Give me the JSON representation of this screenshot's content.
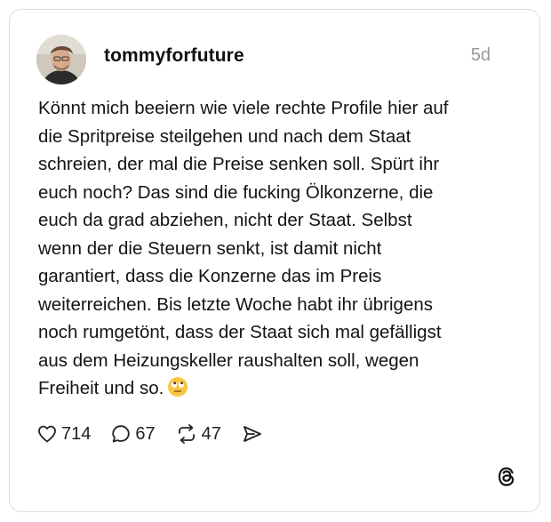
{
  "post": {
    "username": "tommyforfuture",
    "timestamp": "5d",
    "text_lines": [
      "Könnt mich beeiern wie viele rechte Profile hier auf",
      "die Spritpreise steilgehen und nach dem Staat",
      "schreien, der mal die Preise senken soll. Spürt ihr",
      "euch noch? Das sind die fucking Ölkonzerne, die",
      "euch da grad abziehen, nicht der Staat. Selbst",
      "wenn der die Steuern senkt, ist damit nicht",
      "garantiert, dass die Konzerne das im Preis",
      "weiterreichen. Bis letzte Woche habt ihr übrigens",
      "noch rumgetönt, dass der Staat sich mal gefälligst",
      "aus dem Heizungskeller raushalten soll, wegen",
      "Freiheit und so."
    ],
    "emoji": "face-with-rolling-eyes"
  },
  "actions": {
    "likes": "714",
    "comments": "67",
    "reposts": "47"
  },
  "icons": {
    "like": "heart-icon",
    "comment": "comment-icon",
    "repost": "repost-icon",
    "share": "share-icon",
    "brand": "threads-logo-icon"
  }
}
